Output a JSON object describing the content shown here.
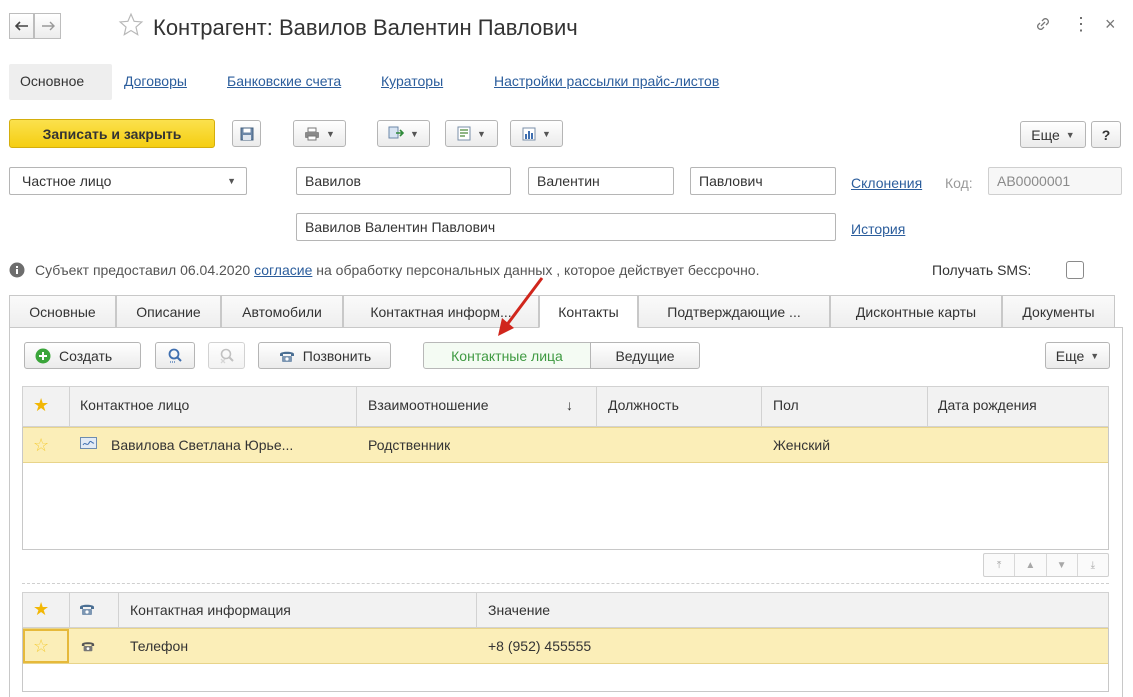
{
  "window": {
    "title": "Контрагент: Вавилов Валентин Павлович",
    "close_glyph": "×",
    "more_glyph": "⋮"
  },
  "section_nav": {
    "items": [
      "Основное",
      "Договоры",
      "Банковские счета",
      "Кураторы",
      "Настройки рассылки прайс-листов"
    ]
  },
  "toolbar": {
    "save_close_label": "Записать и закрыть",
    "more_label": "Еще",
    "help_label": "?"
  },
  "person": {
    "type_value": "Частное лицо",
    "last_name": "Вавилов",
    "first_name": "Валентин",
    "middle_name": "Павлович",
    "declensions_link": "Склонения",
    "code_label": "Код:",
    "code_value": "АВ0000001",
    "full_name": "Вавилов Валентин Павлович",
    "history_link": "История"
  },
  "consent": {
    "text_before": "Субъект предоставил 06.04.2020",
    "link": "согласие",
    "text_after": "на обработку персональных данных , которое действует бессрочно.",
    "sms_label": "Получать SMS:",
    "sms_checked": false
  },
  "tabs": [
    {
      "label": "Основные"
    },
    {
      "label": "Описание"
    },
    {
      "label": "Автомобили"
    },
    {
      "label": "Контактная информ..."
    },
    {
      "label": "Контакты"
    },
    {
      "label": "Подтверждающие ..."
    },
    {
      "label": "Дисконтные карты"
    },
    {
      "label": "Документы"
    }
  ],
  "active_tab": "Контакты",
  "contacts_toolbar": {
    "create_label": "Создать",
    "call_label": "Позвонить",
    "toggle_contacts": "Контактные лица",
    "toggle_leading": "Ведущие",
    "more_label": "Еще"
  },
  "contacts_table": {
    "columns": [
      "Контактное лицо",
      "Взаимоотношение",
      "Должность",
      "Пол",
      "Дата рождения"
    ],
    "sort_indicator": "↓",
    "rows": [
      {
        "name": "Вавилова Светлана  Юрье...",
        "relation": "Родственник",
        "position": "",
        "gender": "Женский",
        "birthdate": ""
      }
    ]
  },
  "contact_info_table": {
    "columns": [
      "Контактная информация",
      "Значение"
    ],
    "rows": [
      {
        "type": "Телефон",
        "value": "+8 (952) 455555"
      }
    ]
  },
  "colors": {
    "accent_yellow": "#f7d11a",
    "selected_row": "#fbeeb8",
    "link": "#2b5d9c",
    "toggle_active_text": "#3f9a42",
    "arrow_red": "#d0261c"
  },
  "icons": [
    "back-arrow-icon",
    "forward-arrow-icon",
    "favorite-star-icon",
    "link-icon",
    "save-icon",
    "print-icon",
    "create-based-icon",
    "report-icon",
    "chart-icon",
    "info-icon",
    "plus-circle-icon",
    "search-icon",
    "cancel-search-icon",
    "phone-icon",
    "contact-card-icon",
    "move-first-icon",
    "move-up-icon",
    "move-down-icon",
    "move-last-icon",
    "annotation-arrow"
  ]
}
